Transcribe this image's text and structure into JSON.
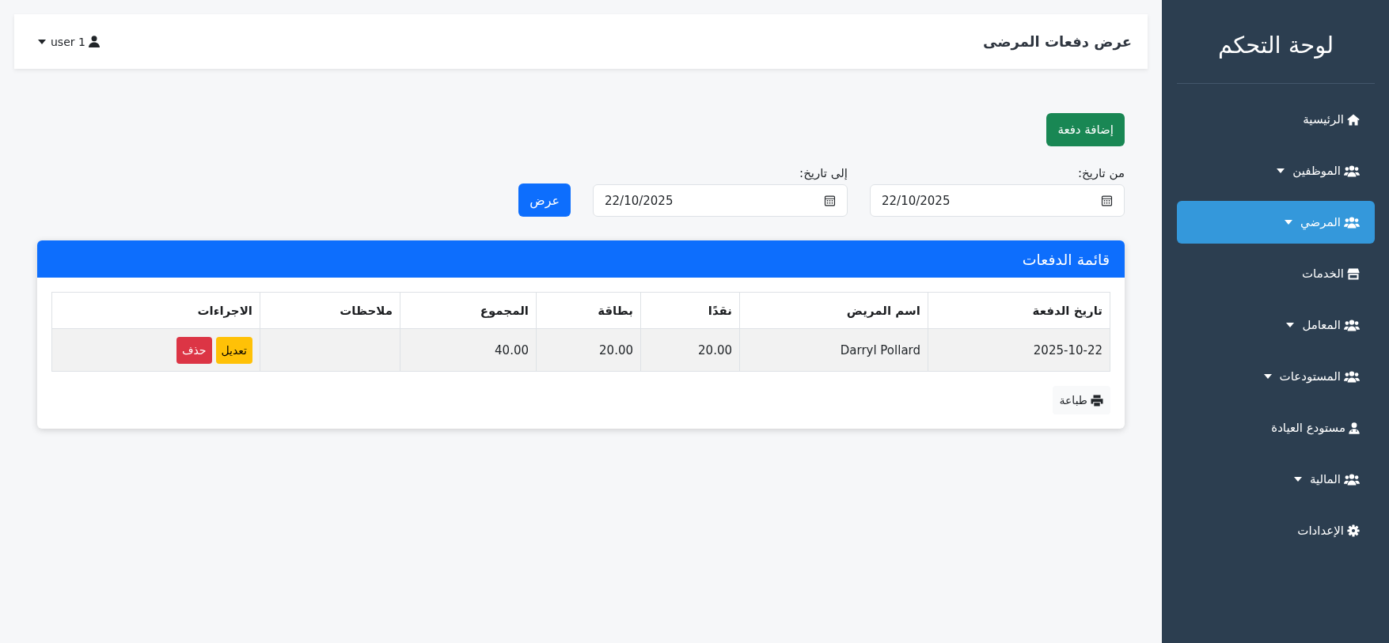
{
  "sidebar": {
    "title": "لوحة التحكم",
    "items": [
      {
        "label": "الرئيسية",
        "kind": "home",
        "has_submenu": false,
        "selected": false
      },
      {
        "label": "الموظفين",
        "kind": "group",
        "has_submenu": true,
        "selected": false
      },
      {
        "label": "المرضي",
        "kind": "group",
        "has_submenu": true,
        "selected": true
      },
      {
        "label": "الخدمات",
        "kind": "store",
        "has_submenu": false,
        "selected": false
      },
      {
        "label": "المعامل",
        "kind": "group",
        "has_submenu": true,
        "selected": false
      },
      {
        "label": "المستودعات",
        "kind": "group",
        "has_submenu": true,
        "selected": false
      },
      {
        "label": "مستودع العيادة",
        "kind": "doctor",
        "has_submenu": false,
        "selected": false
      },
      {
        "label": "المالية",
        "kind": "group",
        "has_submenu": true,
        "selected": false
      },
      {
        "label": "الإعدادات",
        "kind": "settings",
        "has_submenu": false,
        "selected": false
      }
    ]
  },
  "header": {
    "title": "عرض دفعات المرضى",
    "user_menu": {
      "label": "user 1"
    }
  },
  "toolbar": {
    "add_button": "إضافة دفعة"
  },
  "filters": {
    "fields": [
      {
        "label": "من تاريخ:",
        "value": "22/10/2025"
      },
      {
        "label": "إلى تاريخ:",
        "value": "22/10/2025"
      }
    ],
    "submit_button": "عرض"
  },
  "payments_card": {
    "title": "قائمة الدفعات",
    "table": {
      "columns": [
        {
          "label": "تاريخ الدفعة",
          "kind": "text"
        },
        {
          "label": "اسم المريض",
          "kind": "text"
        },
        {
          "label": "نقدًا",
          "kind": "text"
        },
        {
          "label": "بطاقة",
          "kind": "text"
        },
        {
          "label": "المجموع",
          "kind": "text"
        },
        {
          "label": "ملاحظات",
          "kind": "text"
        },
        {
          "label": "الاجراءات",
          "kind": "actions"
        }
      ],
      "rows": [
        {
          "cells": [
            "2025-10-22",
            "Darryl Pollard",
            "20.00",
            "20.00",
            "40.00"
          ],
          "actions": [
            {
              "kind": "edit",
              "label": "تعديل"
            },
            {
              "kind": "delete",
              "label": "حذف"
            }
          ]
        }
      ]
    },
    "print_button": "طباعة"
  }
}
